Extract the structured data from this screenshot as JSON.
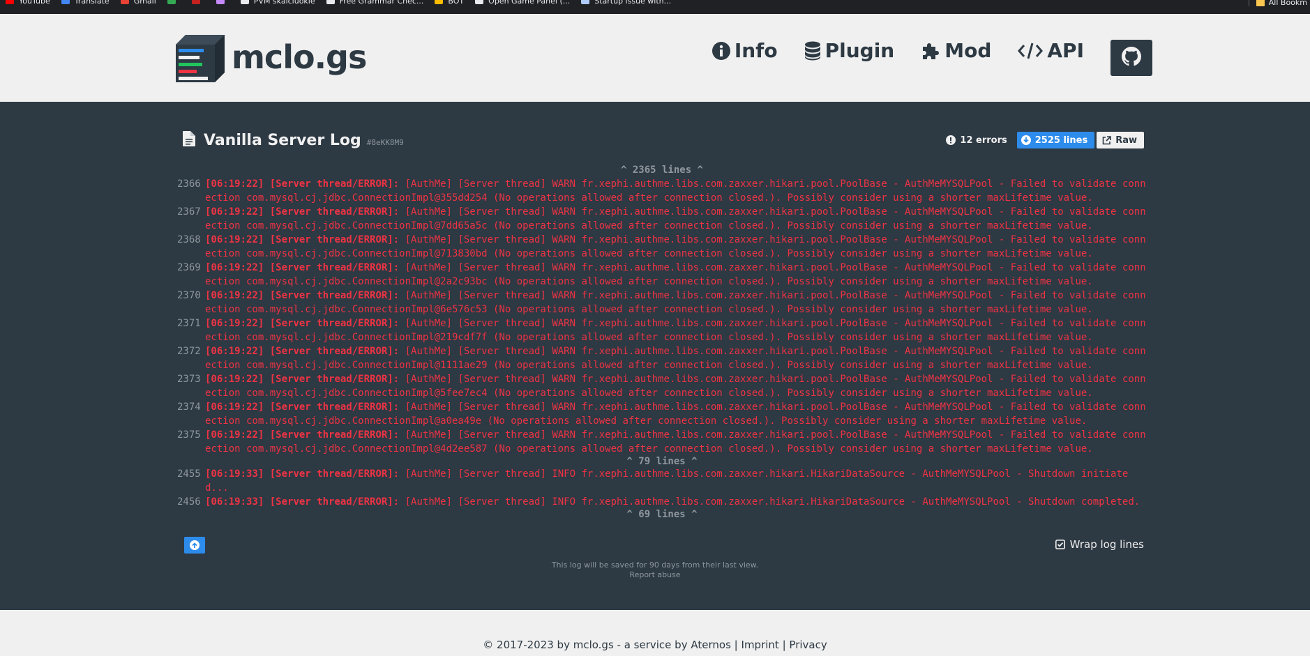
{
  "bookmarks": [
    {
      "label": "YouTube",
      "color": "#ff0000"
    },
    {
      "label": "Translate",
      "color": "#4285f4"
    },
    {
      "label": "Gmail",
      "color": "#ea4335"
    },
    {
      "label": "",
      "color": "#34a853"
    },
    {
      "label": "",
      "color": "#c5221f"
    },
    {
      "label": "",
      "color": "#c58af9"
    },
    {
      "label": "PVM skaiciuokle",
      "color": "#e8eaed"
    },
    {
      "label": "Free Grammar Chec...",
      "color": "#e8eaed"
    },
    {
      "label": "BOT",
      "color": "#fbbc04"
    },
    {
      "label": "Open Game Panel (...",
      "color": "#e8eaed"
    },
    {
      "label": "Startup issue with...",
      "color": "#aecbfa"
    }
  ],
  "bookmarks_all": "All Bookm",
  "header": {
    "logo_text": "mclo.gs",
    "nav": [
      {
        "label": "Info",
        "icon": "info-icon"
      },
      {
        "label": "Plugin",
        "icon": "database-icon"
      },
      {
        "label": "Mod",
        "icon": "puzzle-icon"
      },
      {
        "label": "API",
        "icon": "code-icon"
      }
    ],
    "github_icon": "github-icon"
  },
  "log": {
    "title": "Vanilla Server Log",
    "id": "#8eKK8M9",
    "errors": "12 errors",
    "lines": "2525 lines",
    "raw": "Raw",
    "collapsed_top": "^ 2365 lines ^",
    "collapsed_mid": "^ 79 lines ^",
    "collapsed_bottom": "^ 69 lines ^",
    "entries": [
      {
        "num": "2366",
        "time": "[06:19:22]",
        "thread": "[Server thread/ERROR]:",
        "msg": "[AuthMe] [Server thread] WARN fr.xephi.authme.libs.com.zaxxer.hikari.pool.PoolBase - AuthMeMYSQLPool - Failed to validate connection com.mysql.cj.jdbc.ConnectionImpl@355dd254 (No operations allowed after connection closed.). Possibly consider using a shorter maxLifetime value."
      },
      {
        "num": "2367",
        "time": "[06:19:22]",
        "thread": "[Server thread/ERROR]:",
        "msg": "[AuthMe] [Server thread] WARN fr.xephi.authme.libs.com.zaxxer.hikari.pool.PoolBase - AuthMeMYSQLPool - Failed to validate connection com.mysql.cj.jdbc.ConnectionImpl@7dd65a5c (No operations allowed after connection closed.). Possibly consider using a shorter maxLifetime value."
      },
      {
        "num": "2368",
        "time": "[06:19:22]",
        "thread": "[Server thread/ERROR]:",
        "msg": "[AuthMe] [Server thread] WARN fr.xephi.authme.libs.com.zaxxer.hikari.pool.PoolBase - AuthMeMYSQLPool - Failed to validate connection com.mysql.cj.jdbc.ConnectionImpl@713830bd (No operations allowed after connection closed.). Possibly consider using a shorter maxLifetime value."
      },
      {
        "num": "2369",
        "time": "[06:19:22]",
        "thread": "[Server thread/ERROR]:",
        "msg": "[AuthMe] [Server thread] WARN fr.xephi.authme.libs.com.zaxxer.hikari.pool.PoolBase - AuthMeMYSQLPool - Failed to validate connection com.mysql.cj.jdbc.ConnectionImpl@2a2c93bc (No operations allowed after connection closed.). Possibly consider using a shorter maxLifetime value."
      },
      {
        "num": "2370",
        "time": "[06:19:22]",
        "thread": "[Server thread/ERROR]:",
        "msg": "[AuthMe] [Server thread] WARN fr.xephi.authme.libs.com.zaxxer.hikari.pool.PoolBase - AuthMeMYSQLPool - Failed to validate connection com.mysql.cj.jdbc.ConnectionImpl@6e576c53 (No operations allowed after connection closed.). Possibly consider using a shorter maxLifetime value."
      },
      {
        "num": "2371",
        "time": "[06:19:22]",
        "thread": "[Server thread/ERROR]:",
        "msg": "[AuthMe] [Server thread] WARN fr.xephi.authme.libs.com.zaxxer.hikari.pool.PoolBase - AuthMeMYSQLPool - Failed to validate connection com.mysql.cj.jdbc.ConnectionImpl@219cdf7f (No operations allowed after connection closed.). Possibly consider using a shorter maxLifetime value."
      },
      {
        "num": "2372",
        "time": "[06:19:22]",
        "thread": "[Server thread/ERROR]:",
        "msg": "[AuthMe] [Server thread] WARN fr.xephi.authme.libs.com.zaxxer.hikari.pool.PoolBase - AuthMeMYSQLPool - Failed to validate connection com.mysql.cj.jdbc.ConnectionImpl@1111ae29 (No operations allowed after connection closed.). Possibly consider using a shorter maxLifetime value."
      },
      {
        "num": "2373",
        "time": "[06:19:22]",
        "thread": "[Server thread/ERROR]:",
        "msg": "[AuthMe] [Server thread] WARN fr.xephi.authme.libs.com.zaxxer.hikari.pool.PoolBase - AuthMeMYSQLPool - Failed to validate connection com.mysql.cj.jdbc.ConnectionImpl@5fee7ec4 (No operations allowed after connection closed.). Possibly consider using a shorter maxLifetime value."
      },
      {
        "num": "2374",
        "time": "[06:19:22]",
        "thread": "[Server thread/ERROR]:",
        "msg": "[AuthMe] [Server thread] WARN fr.xephi.authme.libs.com.zaxxer.hikari.pool.PoolBase - AuthMeMYSQLPool - Failed to validate connection com.mysql.cj.jdbc.ConnectionImpl@a0ea49e (No operations allowed after connection closed.). Possibly consider using a shorter maxLifetime value."
      },
      {
        "num": "2375",
        "time": "[06:19:22]",
        "thread": "[Server thread/ERROR]:",
        "msg": "[AuthMe] [Server thread] WARN fr.xephi.authme.libs.com.zaxxer.hikari.pool.PoolBase - AuthMeMYSQLPool - Failed to validate connection com.mysql.cj.jdbc.ConnectionImpl@4d2ee587 (No operations allowed after connection closed.). Possibly consider using a shorter maxLifetime value."
      }
    ],
    "entries2": [
      {
        "num": "2455",
        "time": "[06:19:33]",
        "thread": "[Server thread/ERROR]:",
        "msg": "[AuthMe] [Server thread] INFO fr.xephi.authme.libs.com.zaxxer.hikari.HikariDataSource - AuthMeMYSQLPool - Shutdown initiated..."
      },
      {
        "num": "2456",
        "time": "[06:19:33]",
        "thread": "[Server thread/ERROR]:",
        "msg": "[AuthMe] [Server thread] INFO fr.xephi.authme.libs.com.zaxxer.hikari.HikariDataSource - AuthMeMYSQLPool - Shutdown completed."
      }
    ],
    "wrap_label": "Wrap log lines",
    "wrap_checked": true,
    "save_note": "This log will be saved for 90 days from their last view.",
    "report": "Report abuse"
  },
  "footer": {
    "copyright": "© 2017-2023 by mclo.gs - a service by",
    "aternos": "Aternos",
    "sep1": "|",
    "imprint": "Imprint",
    "sep2": "|",
    "privacy": "Privacy"
  },
  "colors": {
    "dark": "#2d3943",
    "light": "#f0f0f0",
    "accent": "#2d8ceb",
    "error": "#ee3344",
    "muted": "#8e979e"
  }
}
